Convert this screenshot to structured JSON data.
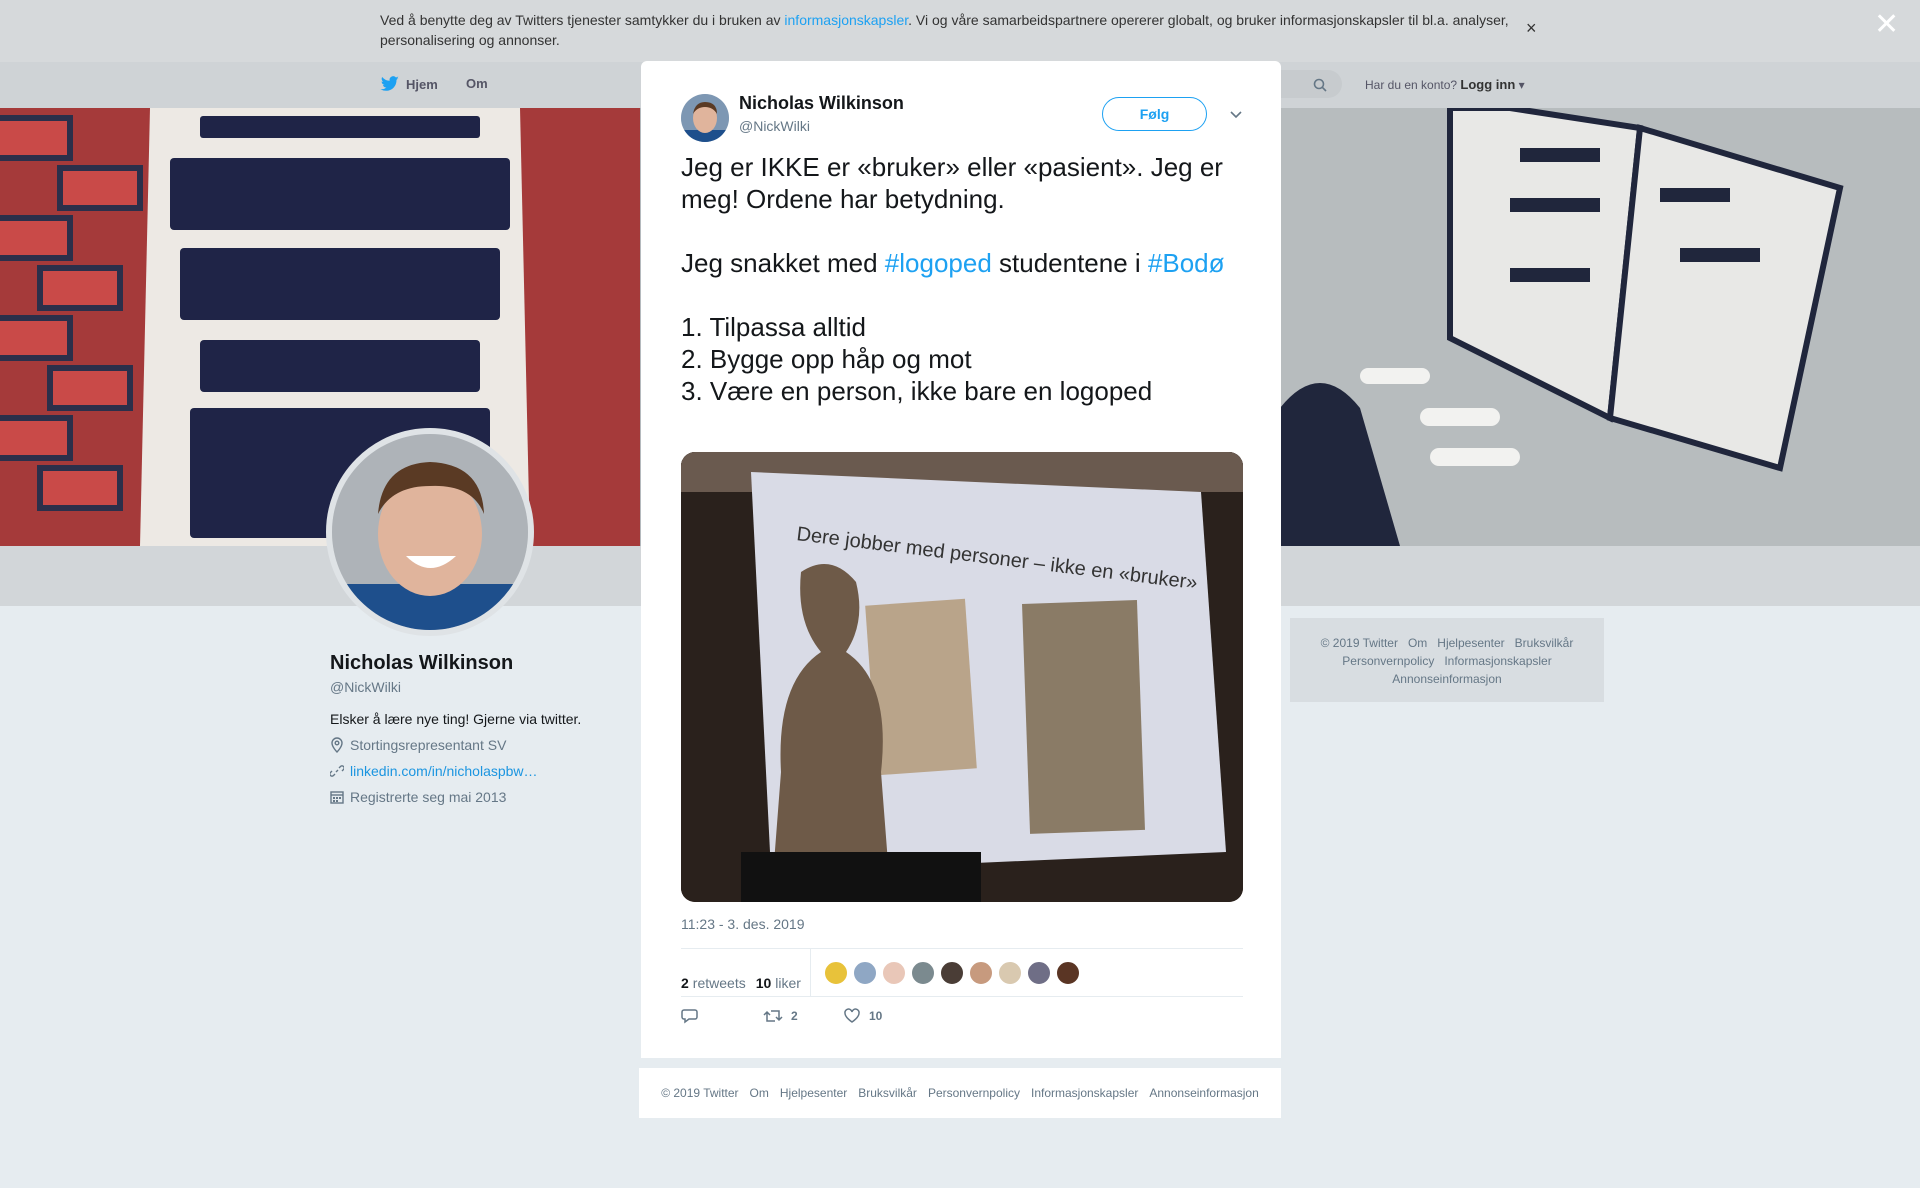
{
  "cookie": {
    "text_before": "Ved å benytte deg av Twitters tjenester samtykker du i bruken av ",
    "link": "informasjonskapsler",
    "text_after": ". Vi og våre samarbeidspartnere opererer globalt, og bruker informasjonskapsler til bl.a. analyser, personalisering og annonser."
  },
  "nav": {
    "home": "Hjem",
    "about": "Om",
    "have_account": "Har du en konto?",
    "login": "Logg inn"
  },
  "profile": {
    "name": "Nicholas Wilkinson",
    "handle": "@NickWilki",
    "bio": "Elsker å lære nye ting! Gjerne via twitter.",
    "location": "Stortingsrepresentant SV",
    "url": "linkedin.com/in/nicholaspbw…",
    "joined": "Registrerte seg mai 2013"
  },
  "side_footer": {
    "items": [
      "© 2019 Twitter",
      "Om",
      "Hjelpesenter",
      "Bruksvilkår",
      "Personvernpolicy",
      "Informasjonskapsler",
      "Annonseinformasjon"
    ]
  },
  "tweet": {
    "name": "Nicholas Wilkinson",
    "handle": "@NickWilki",
    "follow": "Følg",
    "line1": "Jeg er IKKE er «bruker» eller «pasient». Jeg er meg! Ordene har betydning.",
    "line2_a": "Jeg snakket med ",
    "line2_tag1": "#logoped",
    "line2_b": " studentene i ",
    "line2_tag2": "#Bodø",
    "list": [
      "1. Tilpassa alltid",
      "2. Bygge opp håp og mot",
      "3. Være en person, ikke bare en logoped"
    ],
    "slide_text": "Dere jobber med personer – ikke en «bruker»",
    "time": "11:23 - 3. des. 2019",
    "retweets_count": "2",
    "retweets_label": "retweets",
    "likes_count": "10",
    "likes_label": "liker",
    "action_retweets": "2",
    "action_likes": "10"
  },
  "modal_footer": {
    "items": [
      "© 2019 Twitter",
      "Om",
      "Hjelpesenter",
      "Bruksvilkår",
      "Personvernpolicy",
      "Informasjonskapsler",
      "Annonseinformasjon"
    ]
  },
  "colors": {
    "accent": "#1da1f2",
    "text": "#14171a",
    "muted": "#657786"
  }
}
